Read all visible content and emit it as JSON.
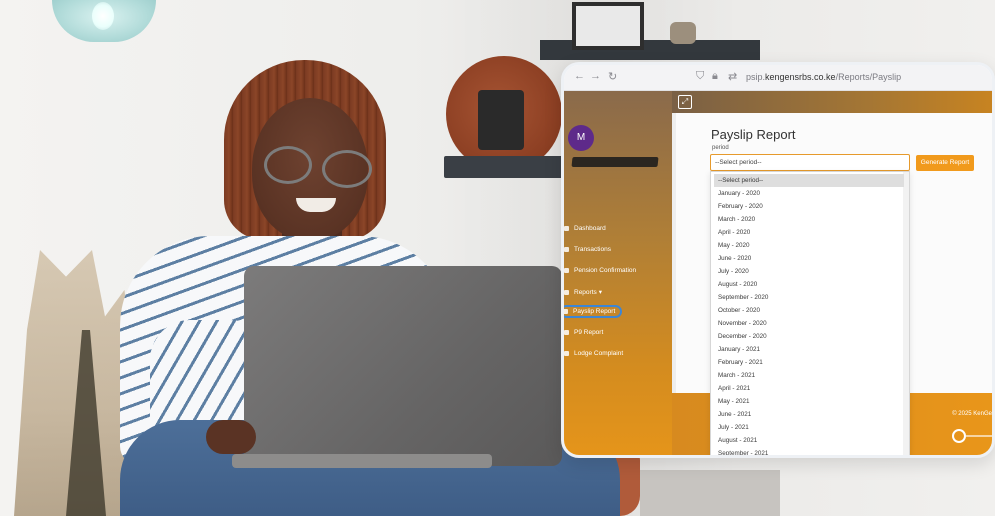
{
  "browser": {
    "url_prefix": "psip.",
    "url_domain": "kengensrbs.co.ke",
    "url_path": "/Reports/Payslip",
    "icons": [
      "back-icon",
      "forward-icon",
      "reload-icon",
      "shield-icon",
      "lock-icon",
      "site-info-icon"
    ]
  },
  "user": {
    "avatar_letter": "M"
  },
  "sidebar": {
    "items": [
      {
        "label": "Dashboard",
        "icon": "dashboard-icon"
      },
      {
        "label": "Transactions",
        "icon": "transactions-icon"
      },
      {
        "label": "Pension Confirmation",
        "icon": "pension-icon"
      },
      {
        "label": "Reports",
        "icon": "reports-icon"
      },
      {
        "label": "Payslip Report",
        "icon": "payslip-icon",
        "active": true
      },
      {
        "label": "P9 Report",
        "icon": "p9-icon"
      },
      {
        "label": "Lodge Complaint",
        "icon": "complaint-icon"
      }
    ],
    "reports_caret": "▾"
  },
  "page": {
    "title": "Payslip Report",
    "period_label": "period",
    "select_value": "--Select period--",
    "generate_button": "Generate Report"
  },
  "dropdown": {
    "options": [
      "--Select period--",
      "January - 2020",
      "February - 2020",
      "March - 2020",
      "April - 2020",
      "May - 2020",
      "June - 2020",
      "July - 2020",
      "August - 2020",
      "September - 2020",
      "October - 2020",
      "November - 2020",
      "December - 2020",
      "January - 2021",
      "February - 2021",
      "March - 2021",
      "April - 2021",
      "May - 2021",
      "June - 2021",
      "July - 2021",
      "August - 2021",
      "September - 2021"
    ],
    "selected_index": 0
  },
  "footer": {
    "text": "© 2025 KenGe"
  },
  "colors": {
    "accent": "#f19a1c",
    "sidebar_top": "#8a6a4b",
    "sidebar_bottom": "#e6951a",
    "avatar": "#5e2a8a",
    "highlight_ring": "#3c86d6"
  }
}
